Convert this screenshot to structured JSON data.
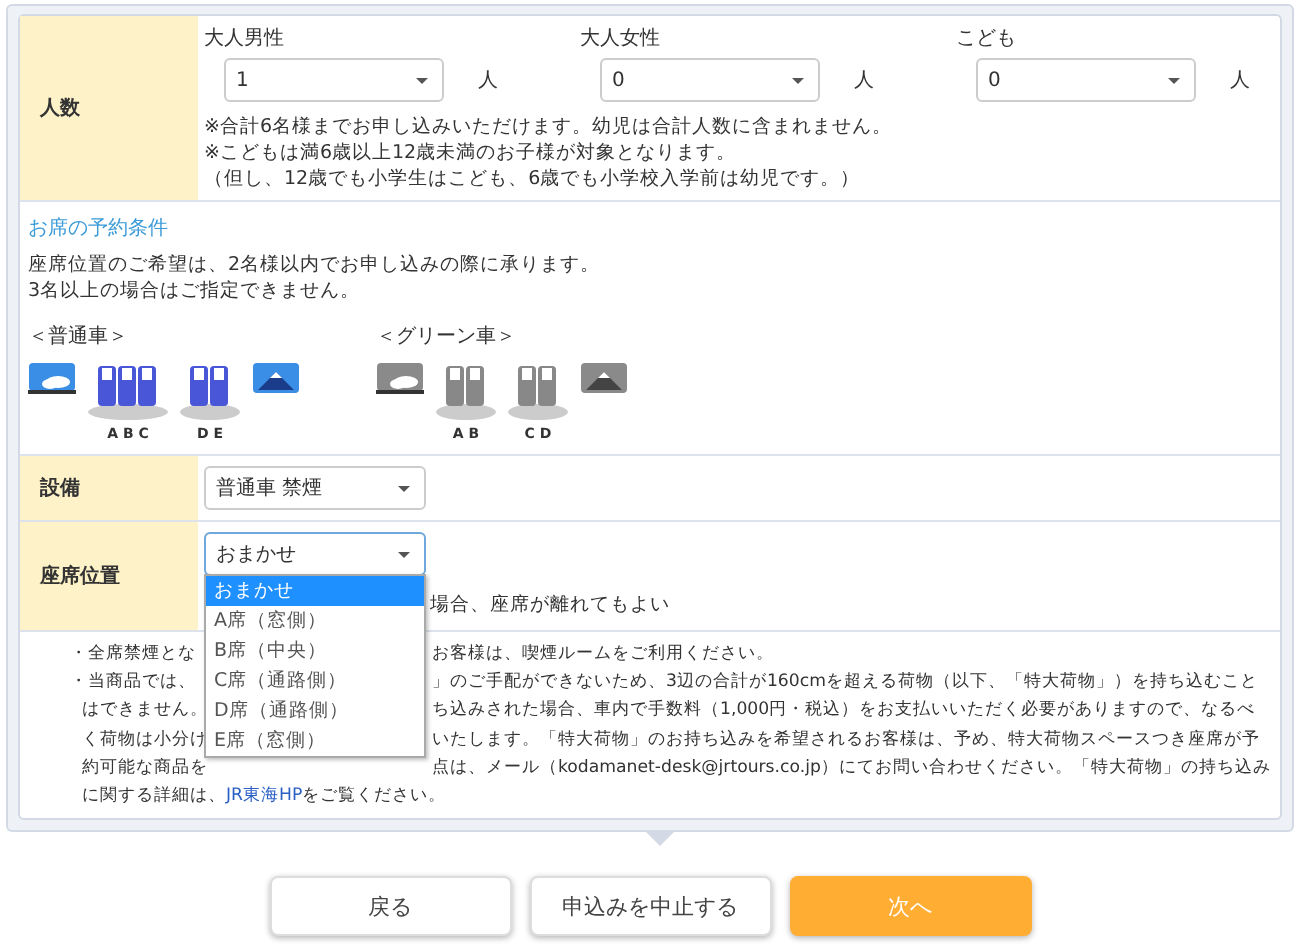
{
  "party": {
    "label": "人数",
    "groups": [
      {
        "label": "大人男性",
        "value": "1",
        "unit": "人"
      },
      {
        "label": "大人女性",
        "value": "0",
        "unit": "人"
      },
      {
        "label": "こども",
        "value": "0",
        "unit": "人"
      }
    ],
    "notes": [
      "※合計6名様までお申し込みいただけます。幼児は合計人数に含まれません。",
      "※こどもは満6歳以上12歳未満のお子様が対象となります。",
      "（但し、12歳でも小学生はこども、6歳でも小学校入学前は幼児です。）"
    ]
  },
  "conditions": {
    "title": "お席の予約条件",
    "lines": [
      "座席位置のご希望は、2名様以内でお申し込みの際に承ります。",
      "3名以上の場合はご指定できません。"
    ],
    "seat_maps": [
      {
        "title": "＜普通車＞",
        "kind": "ordinary",
        "labels": [
          "A B C",
          "D E"
        ]
      },
      {
        "title": "＜グリーン車＞",
        "kind": "green",
        "labels": [
          "A B",
          "C D"
        ]
      }
    ]
  },
  "facility": {
    "label": "設備",
    "value": "普通車 禁煙"
  },
  "seat_position": {
    "label": "座席位置",
    "value": "おまかせ",
    "open": true,
    "options": [
      {
        "label": "おまかせ",
        "selected": true
      },
      {
        "label": "A席（窓側）",
        "selected": false
      },
      {
        "label": "B席（中央）",
        "selected": false
      },
      {
        "label": "C席（通路側）",
        "selected": false
      },
      {
        "label": "D席（通路側）",
        "selected": false
      },
      {
        "label": "E席（窓側）",
        "selected": false
      }
    ],
    "note": "場合、座席が離れてもよい"
  },
  "notes": [
    {
      "left": "・全席禁煙とな",
      "right": "お客様は、喫煙ルームをご利用ください。"
    },
    {
      "left": "・当商品では、",
      "right": "」のご手配ができないため、3辺の合計が160cmを超える荷物（以下、「特大荷物」）を持ち込むこと"
    },
    {
      "left": "はできません。",
      "right": "ち込みされた場合、車内で手数料（1,000円・税込）をお支払いいただく必要がありますので、なるべ"
    },
    {
      "left": "く荷物は小分け",
      "right": "いたします。「特大荷物」のお持ち込みを希望されるお客様は、予め、特大荷物スペースつき座席が予"
    },
    {
      "left": "約可能な商品を",
      "right": "点は、メール（kodamanet-desk@jrtours.co.jp）にてお問い合わせください。「特大荷物」の持ち込み"
    }
  ],
  "notes_last": {
    "before": "に関する詳細は、",
    "link": "JR東海HP",
    "after": "をご覧ください。"
  },
  "buttons": [
    {
      "label": "戻る",
      "kind": "secondary"
    },
    {
      "label": "申込みを中止する",
      "kind": "secondary"
    },
    {
      "label": "次へ",
      "kind": "primary"
    }
  ]
}
